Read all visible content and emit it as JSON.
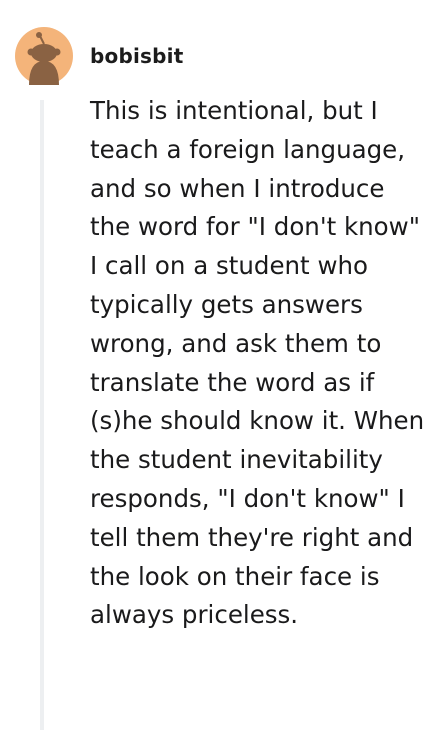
{
  "comment": {
    "username": "bobisbit",
    "avatar_icon": "snoo-avatar-icon",
    "avatar_bg_color": "#f4b47a",
    "avatar_fg_color": "#8a6243",
    "body": "This is intentional, but I teach a foreign language, and so when I introduce the word for \"I don't know\" I call on a student who typically gets answers wrong, and ask them to translate the word as if (s)he should know it. When the student inevitability responds, \"I don't know\" I tell them they're right and the look on their face is always priceless."
  }
}
